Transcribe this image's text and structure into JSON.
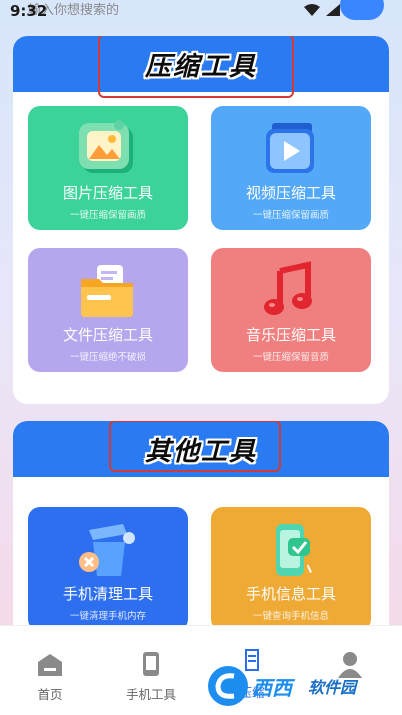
{
  "status_bar": {
    "time": "9:32",
    "search_hint": "输入你想搜索的"
  },
  "sections": [
    {
      "title": "压缩工具",
      "cards": [
        {
          "title": "图片压缩工具",
          "subtitle": "一键压缩保留画质",
          "color": "#3bd39a",
          "icon": "image-icon"
        },
        {
          "title": "视频压缩工具",
          "subtitle": "一键压缩保留画质",
          "color": "#53a9f8",
          "icon": "video-play-icon"
        },
        {
          "title": "文件压缩工具",
          "subtitle": "一键压缩绝不破损",
          "color": "#b5a6ee",
          "icon": "folder-icon"
        },
        {
          "title": "音乐压缩工具",
          "subtitle": "一键压缩保留音质",
          "color": "#f07f7f",
          "icon": "music-note-icon"
        }
      ]
    },
    {
      "title": "其他工具",
      "cards": [
        {
          "title": "手机清理工具",
          "subtitle": "一键清理手机内存",
          "color": "#2e6ff0",
          "icon": "trash-icon"
        },
        {
          "title": "手机信息工具",
          "subtitle": "一键查询手机信息",
          "color": "#eeaa35",
          "icon": "phone-check-icon"
        }
      ]
    }
  ],
  "bottom_nav": [
    {
      "label": "首页",
      "icon": "home-icon"
    },
    {
      "label": "手机工具",
      "icon": "phone-icon"
    },
    {
      "label": "压缩",
      "icon": "compress-icon"
    },
    {
      "label": "",
      "icon": "profile-icon"
    }
  ],
  "watermark": {
    "brand": "西西",
    "url": "软件园"
  }
}
